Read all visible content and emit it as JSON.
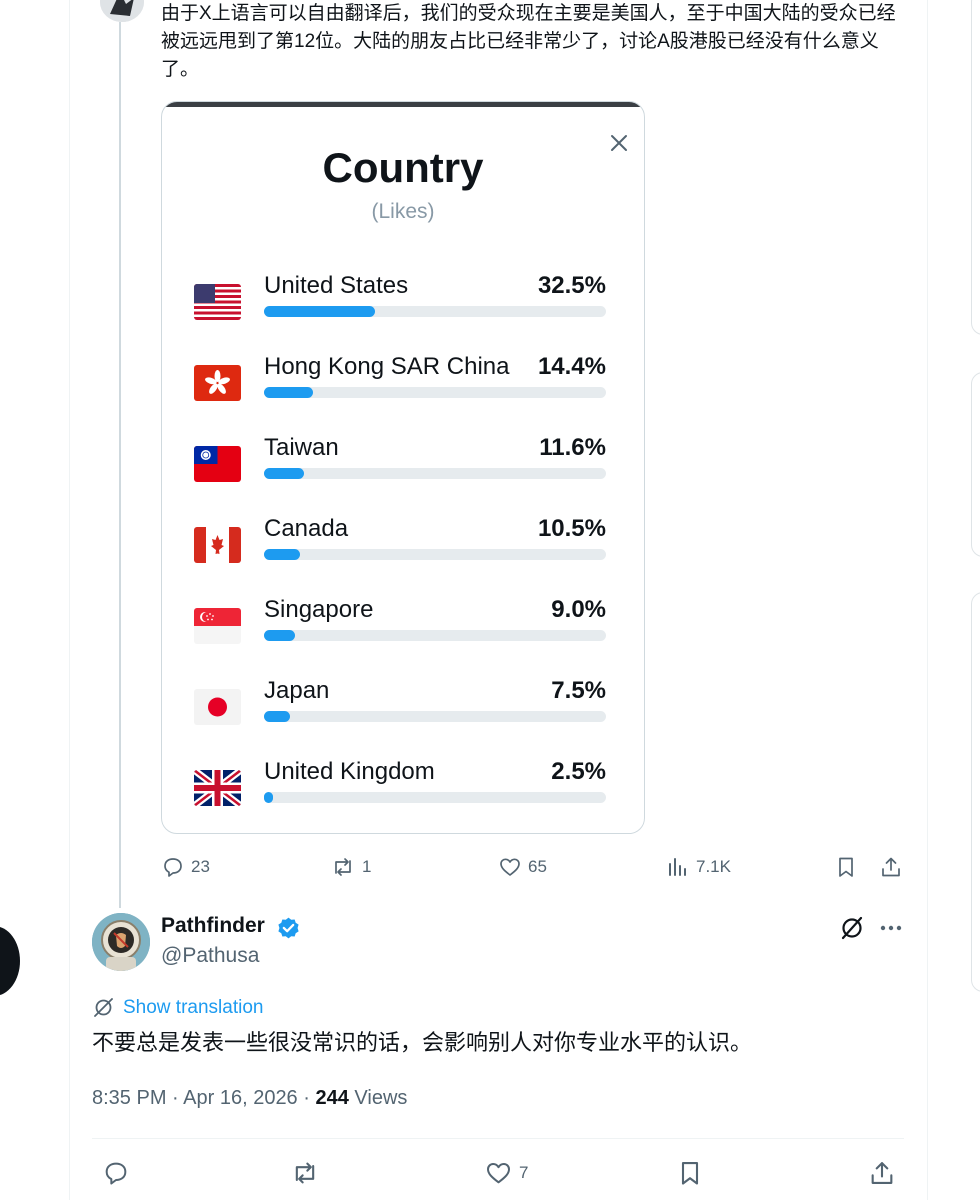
{
  "parent_tweet": {
    "text": "由于X上语言可以自由翻译后，我们的受众现在主要是美国人，至于中国大陆的受众已经被远远甩到了第12位。大陆的朋友占比已经非常少了，讨论A股港股已经没有什么意义了。",
    "actions": {
      "replies": "23",
      "reposts": "1",
      "likes": "65",
      "views": "7.1K"
    }
  },
  "media_card": {
    "title": "Country",
    "subtitle": "(Likes)",
    "close_icon": "close-icon"
  },
  "chart_data": {
    "type": "bar",
    "title": "Country",
    "subtitle": "(Likes)",
    "unit": "%",
    "categories": [
      "United States",
      "Hong Kong SAR China",
      "Taiwan",
      "Canada",
      "Singapore",
      "Japan",
      "United Kingdom"
    ],
    "values": [
      32.5,
      14.4,
      11.6,
      10.5,
      9.0,
      7.5,
      2.5
    ],
    "labels": [
      "32.5%",
      "14.4%",
      "11.6%",
      "10.5%",
      "9.0%",
      "7.5%",
      "2.5%"
    ],
    "xlim": [
      0,
      100
    ],
    "bar_color": "#1d9bf0",
    "track_color": "#e6ebee"
  },
  "reply": {
    "name": "Pathfinder",
    "handle": "@Pathusa",
    "show_translation": "Show translation",
    "text": "不要总是发表一些很没常识的话，会影响别人对你专业水平的认识。",
    "meta_time": "8:35 PM · Apr 16, 2026 · ",
    "views_count": "244",
    "views_label": " Views",
    "likes": "7"
  },
  "colors": {
    "accent": "#1d9bf0",
    "muted": "#536471",
    "text": "#0f1419"
  }
}
